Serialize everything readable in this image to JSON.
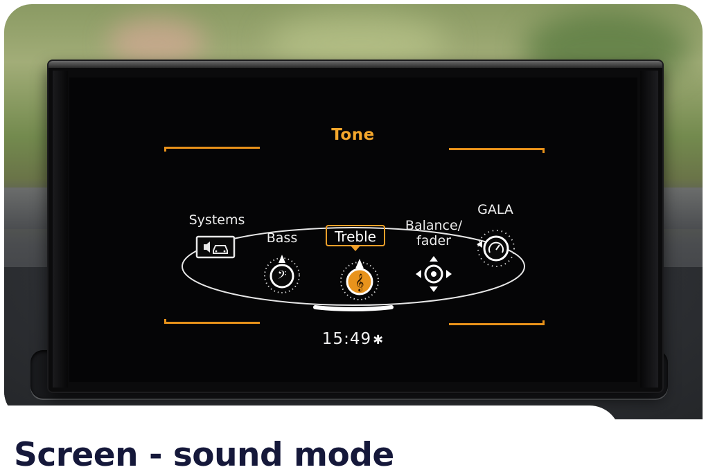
{
  "screen": {
    "title": "Tone",
    "menu": [
      {
        "label": "Systems",
        "icon": "speaker-car-icon",
        "selected": false
      },
      {
        "label": "Bass",
        "icon": "bass-clef-knob-icon",
        "selected": false
      },
      {
        "label": "Treble",
        "icon": "treble-clef-knob-icon",
        "selected": true
      },
      {
        "label": "Balance/\nfader",
        "icon": "balance-fader-icon",
        "selected": false
      },
      {
        "label": "GALA",
        "icon": "gala-speedometer-icon",
        "selected": false
      }
    ],
    "time": "15:49",
    "status_icon": "bluetooth-icon"
  },
  "caption": "Screen - sound mode",
  "colors": {
    "accent": "#f0a02a",
    "text": "#ececec",
    "caption": "#15183a"
  }
}
